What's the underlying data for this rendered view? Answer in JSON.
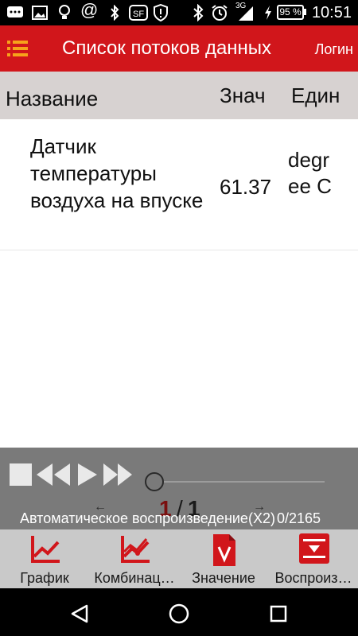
{
  "status_bar": {
    "time": "10:51",
    "battery_percent": "95 %",
    "network_label": "3G"
  },
  "app_bar": {
    "title": "Список потоков данных",
    "login_label": "Логин"
  },
  "table": {
    "columns": [
      "Название",
      "Знач",
      "Един"
    ],
    "rows": [
      {
        "name": "Датчик температуры воздуха на впуске",
        "value": "61.37",
        "unit": "degree C"
      }
    ]
  },
  "playback": {
    "page_current": "1",
    "page_separator": "/",
    "page_total": "1",
    "autoplay_label": "Автоматическое воспроизведение(X2)",
    "counter": "0/2165"
  },
  "toolbar": {
    "items": [
      {
        "label": "График",
        "icon": "line-chart-icon"
      },
      {
        "label": "Комбинац…",
        "icon": "combined-chart-icon"
      },
      {
        "label": "Значение",
        "icon": "value-document-icon"
      },
      {
        "label": "Воспроиз…",
        "icon": "playback-record-icon"
      }
    ]
  },
  "colors": {
    "brand_red": "#d1161b",
    "header_gray": "#d7d2d1",
    "playback_gray": "#7a7a7a",
    "toolbar_gray": "#c9c9c9",
    "accent_orange": "#f7a21b"
  }
}
